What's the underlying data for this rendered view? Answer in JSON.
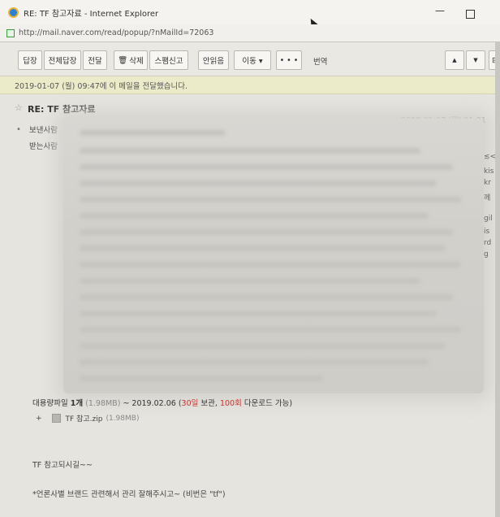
{
  "window": {
    "title": "RE: TF 참고자료 - Internet Explorer",
    "url": "http://mail.naver.com/read/popup/?nMailId=72063"
  },
  "toolbar": {
    "reply": "답장",
    "reply_all": "전체답장",
    "forward": "전달",
    "delete": "삭제",
    "spam": "스팸신고",
    "unread": "안읽음",
    "move": "이동 ▾",
    "more": "• • •",
    "translate": "번역",
    "up": "▲",
    "down": "▼",
    "print": "⊟"
  },
  "notice": "2019-01-07 (월) 09:47에 이 메일을 전달했습니다.",
  "mail": {
    "subject": "RE: TF 참고자료",
    "date": "2019-01-07 (월) 01:21",
    "sender_label": "보낸사람",
    "receiver_label": "받는사람",
    "side_fragments": [
      "≲<",
      "kis",
      "kr",
      "께",
      "gil",
      "is",
      "rd",
      "g"
    ]
  },
  "attachment": {
    "head_prefix": "대용량파일",
    "count": "1개",
    "size": "(1.98MB)",
    "range": "~ 2019.02.06 (",
    "keep_days": "30일",
    "keep_label": "보관,",
    "downloads": "100회",
    "download_label": "다운로드 가능)",
    "expand": "+",
    "file_name": "TF 참고.zip",
    "file_size": "(1.98MB)"
  },
  "body": {
    "line1": "TF 참고되시길~~",
    "line2": "*언론사별 브랜드 관련해서 관리 잘해주시고~ (비번은 \"tf\")"
  },
  "colors": {
    "notice_bg": "#ecebc9",
    "accent_red": "#c3362f"
  }
}
